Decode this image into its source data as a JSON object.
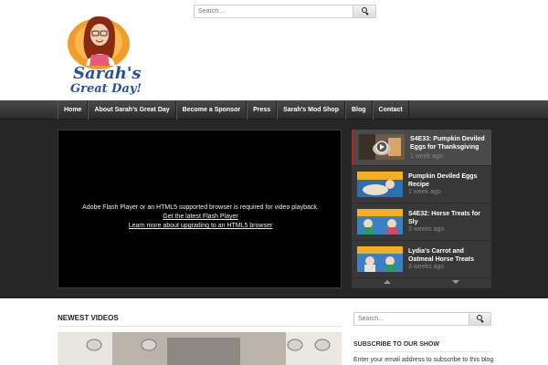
{
  "header": {
    "logo_line1": "Sarah's",
    "logo_line2": "Great Day!",
    "search_placeholder": "Search..."
  },
  "nav": {
    "items": [
      {
        "label": "Home"
      },
      {
        "label": "About Sarah’s Great Day"
      },
      {
        "label": "Become a Sponsor"
      },
      {
        "label": "Press"
      },
      {
        "label": "Sarah’s Mod Shop"
      },
      {
        "label": "Blog"
      },
      {
        "label": "Contact"
      }
    ]
  },
  "player": {
    "message": "Adobe Flash Player or an HTML5 supported browser is required for video playback.",
    "link1": "Get the latest Flash Player",
    "link2": "Learn more about upgrading to an HTML5 browser"
  },
  "playlist": {
    "items": [
      {
        "title": "S4E33: Pumpkin Deviled Eggs for Thanksgiving",
        "age": "1 week ago"
      },
      {
        "title": "Pumpkin Deviled Eggs Recipe",
        "age": "1 week ago"
      },
      {
        "title": "S4E32: Horse Treats for Sly",
        "age": "3 weeks ago"
      },
      {
        "title": "Lydia’s Carrot and Oatmeal Horse Treats",
        "age": "3 weeks ago"
      }
    ]
  },
  "newest": {
    "title": "NEWEST VIDEOS"
  },
  "sidebar": {
    "search_placeholder": "Search...",
    "subscribe_title": "SUBSCRIBE TO OUR SHOW",
    "subscribe_text": "Enter your email address to subscribe to this blog"
  },
  "colors": {
    "accent": "#c71a1a",
    "nav_bg": "#3a3a3a",
    "featured_bg": "#262626",
    "logo_blue": "#2a4f9e"
  }
}
